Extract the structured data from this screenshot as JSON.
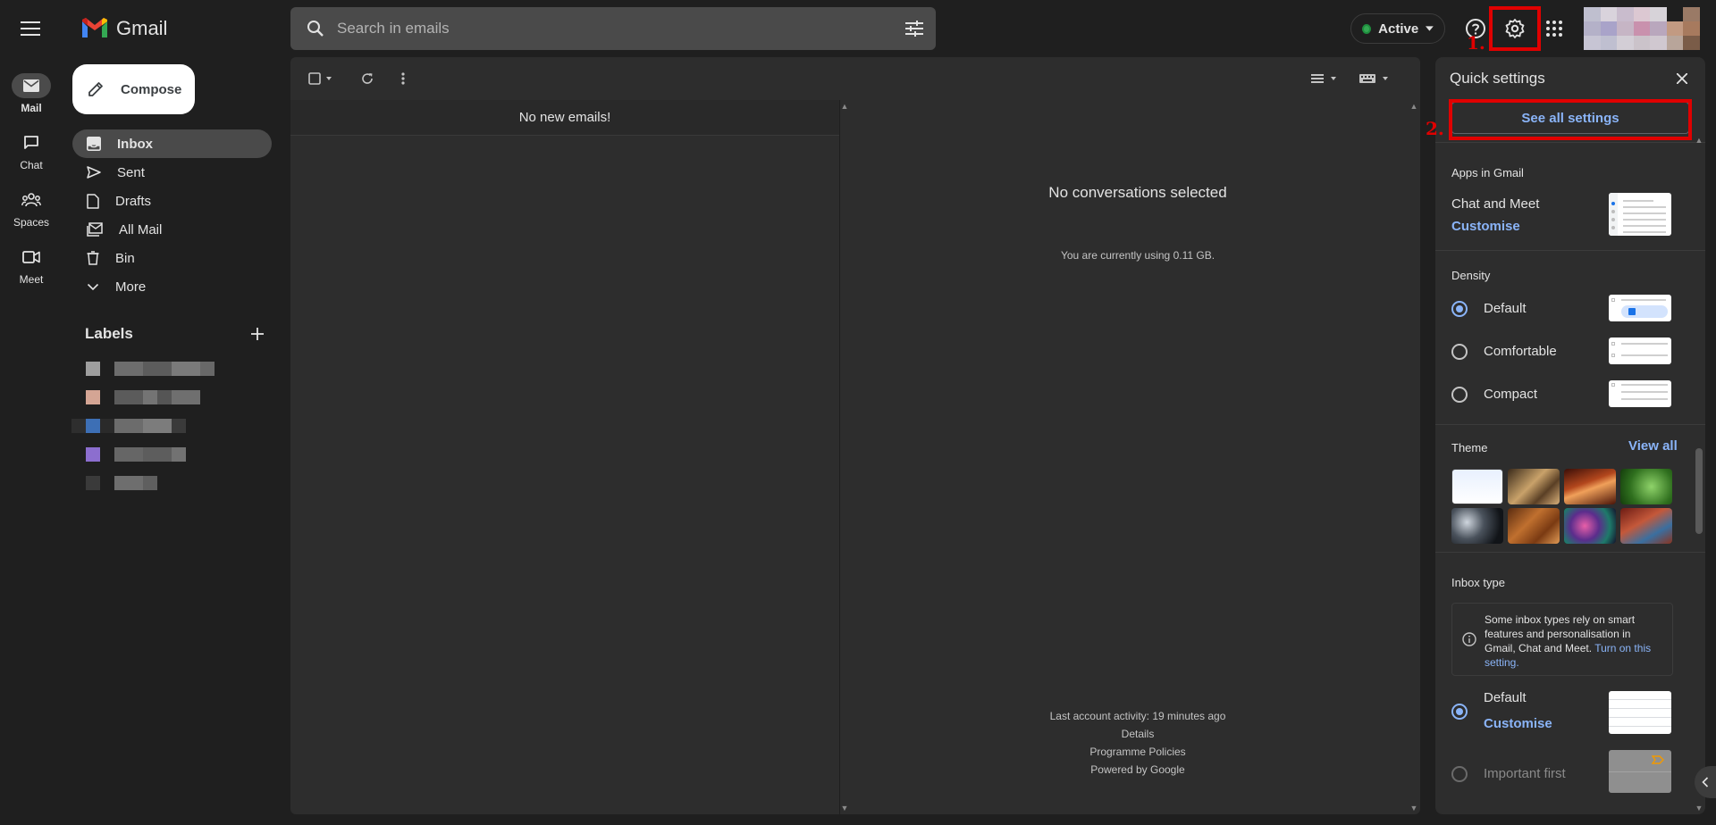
{
  "header": {
    "app_name": "Gmail",
    "search_placeholder": "Search in emails",
    "status": "Active",
    "status_color": "#34a853",
    "icons": [
      "menu-icon",
      "search-icon",
      "filter-icon",
      "help-icon",
      "gear-icon",
      "apps-icon"
    ]
  },
  "annotations": {
    "step1": "1.",
    "step2": "2.",
    "highlight_color": "#e00000"
  },
  "rail": {
    "items": [
      {
        "label": "Mail",
        "icon": "mail-icon",
        "active": true
      },
      {
        "label": "Chat",
        "icon": "chat-icon",
        "active": false
      },
      {
        "label": "Spaces",
        "icon": "spaces-icon",
        "active": false
      },
      {
        "label": "Meet",
        "icon": "meet-icon",
        "active": false
      }
    ]
  },
  "sidebar": {
    "compose_label": "Compose",
    "items": [
      {
        "label": "Inbox",
        "icon": "inbox-icon",
        "active": true
      },
      {
        "label": "Sent",
        "icon": "send-icon",
        "active": false
      },
      {
        "label": "Drafts",
        "icon": "draft-icon",
        "active": false
      },
      {
        "label": "All Mail",
        "icon": "all-mail-icon",
        "active": false
      },
      {
        "label": "Bin",
        "icon": "bin-icon",
        "active": false
      },
      {
        "label": "More",
        "icon": "chevron-down-icon",
        "active": false
      }
    ],
    "labels_title": "Labels",
    "label_colors": [
      "#9e9e9e",
      "#d4a594",
      "#3d6fb5",
      "#8c6ecf",
      "#3a3a3a"
    ]
  },
  "list": {
    "empty_text": "No new emails!"
  },
  "reading": {
    "title": "No conversations selected",
    "storage": "You are currently using 0.11 GB.",
    "footer": {
      "activity": "Last account activity: 19 minutes ago",
      "details": "Details",
      "policies": "Programme Policies",
      "powered": "Powered by Google"
    }
  },
  "quick_settings": {
    "title": "Quick settings",
    "see_all": "See all settings",
    "apps_title": "Apps in Gmail",
    "apps_item": "Chat and Meet",
    "customise": "Customise",
    "density_title": "Density",
    "density_options": [
      {
        "label": "Default",
        "selected": true
      },
      {
        "label": "Comfortable",
        "selected": false
      },
      {
        "label": "Compact",
        "selected": false
      }
    ],
    "theme_title": "Theme",
    "view_all": "View all",
    "inbox_type_title": "Inbox type",
    "inbox_info_text": "Some inbox types rely on smart features and personalisation in Gmail, Chat and Meet.",
    "inbox_info_link": "Turn on this setting.",
    "inbox_options": [
      {
        "label": "Default",
        "selected": true
      },
      {
        "label": "Important first",
        "selected": false
      }
    ],
    "inbox_customise": "Customise",
    "accent_color": "#8ab4f8"
  }
}
